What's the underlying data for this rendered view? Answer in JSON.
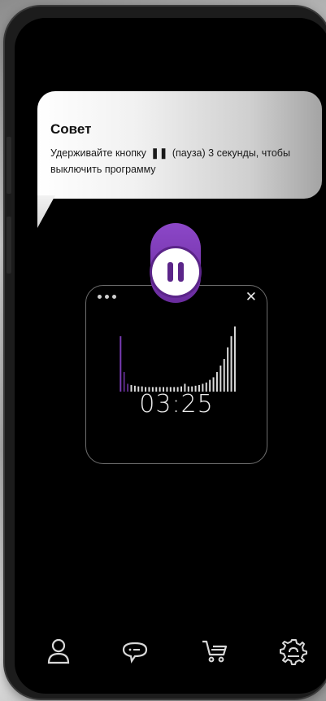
{
  "tip": {
    "title": "Совет",
    "text_before": "Удерживайте кнопку",
    "glyph": "❚❚",
    "text_after": "(пауза) 3 секунды, чтобы выключить программу"
  },
  "player": {
    "timer": "03:25",
    "state": "paused",
    "close_symbol": "✕",
    "accent_color": "#6a2c9e",
    "waveform_levels": [
      0.85,
      0.3,
      0.12,
      0.1,
      0.09,
      0.08,
      0.08,
      0.07,
      0.07,
      0.07,
      0.07,
      0.07,
      0.07,
      0.07,
      0.07,
      0.07,
      0.07,
      0.08,
      0.12,
      0.08,
      0.08,
      0.09,
      0.1,
      0.12,
      0.14,
      0.18,
      0.22,
      0.3,
      0.4,
      0.5,
      0.68,
      0.85,
      1.0
    ]
  },
  "navbar": {
    "items": [
      {
        "icon": "user-icon"
      },
      {
        "icon": "chat-icon"
      },
      {
        "icon": "cart-icon"
      },
      {
        "icon": "gear-icon"
      }
    ]
  }
}
